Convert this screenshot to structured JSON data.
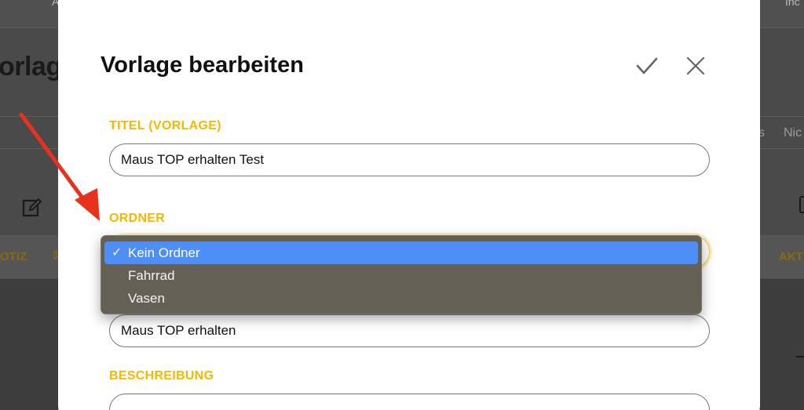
{
  "background": {
    "top_left_text": "A",
    "top_right_text": "Inc",
    "page_title": "orlage",
    "right_tab_text_1": "s",
    "right_tab_text_2": "Nic",
    "column_left": "OTIZ",
    "column_right": "AKT"
  },
  "modal": {
    "title": "Vorlage bearbeiten",
    "confirm_icon": "checkmark-icon",
    "close_icon": "close-icon"
  },
  "form": {
    "title_label": "TITEL (VORLAGE)",
    "title_value": "Maus TOP erhalten Test",
    "folder_label": "ORDNER",
    "folder_value": "Kein Ordner",
    "folder_options": [
      {
        "label": "Kein Ordner",
        "selected": true
      },
      {
        "label": "Fahrrad",
        "selected": false
      },
      {
        "label": "Vasen",
        "selected": false
      }
    ],
    "subject_value": "Maus TOP erhalten",
    "description_label": "BESCHREIBUNG",
    "description_value": ""
  },
  "colors": {
    "accent": "#f5b800",
    "selection": "#4d8ef7",
    "annotation_arrow": "#e8321e"
  }
}
